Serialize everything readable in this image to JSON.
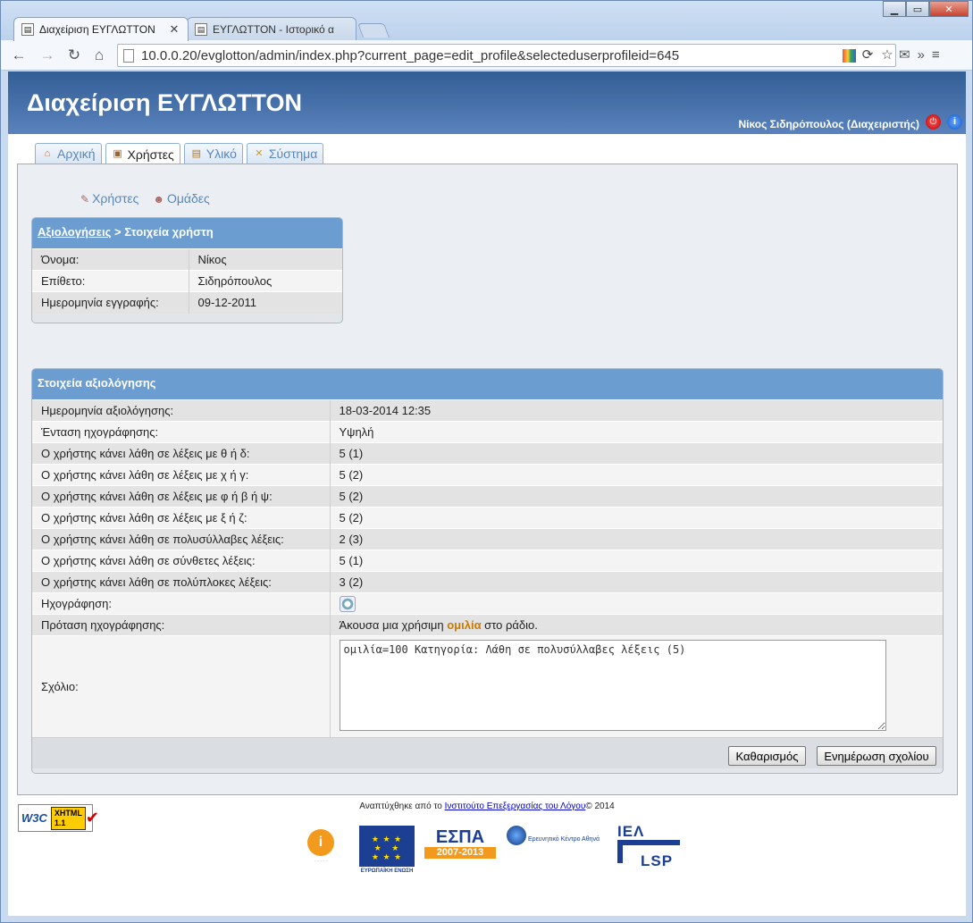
{
  "browser": {
    "tabs": [
      {
        "title": "Διαχείριση ΕΥΓΛΩΤΤΟΝ",
        "active": true
      },
      {
        "title": "ΕΥΓΛΩΤΤΟΝ - Ιστορικό α",
        "active": false
      }
    ],
    "url": "10.0.0.20/evglotton/admin/index.php?current_page=edit_profile&selecteduserprofileid=645",
    "icons": [
      "back-icon",
      "forward-icon",
      "reload-icon",
      "home-icon",
      "star-icon",
      "gmail-icon",
      "extensions-icon",
      "wrench-icon"
    ]
  },
  "header": {
    "title": "Διαχείριση ΕΥΓΛΩΤΤΟΝ",
    "user": "Νίκος Σιδηρόπουλος (Διαχειριστής)"
  },
  "main_tabs": [
    {
      "label": "Αρχική",
      "icon": "home-icon",
      "active": false
    },
    {
      "label": "Χρήστες",
      "icon": "users-icon",
      "active": true
    },
    {
      "label": "Υλικό",
      "icon": "book-icon",
      "active": false
    },
    {
      "label": "Σύστημα",
      "icon": "tools-icon",
      "active": false
    }
  ],
  "subnav": [
    {
      "label": "Χρήστες",
      "icon": "pencil-icon"
    },
    {
      "label": "Ομάδες",
      "icon": "group-icon"
    }
  ],
  "user_box": {
    "breadcrumb_link": "Αξιολογήσεις",
    "breadcrumb_sep": " > ",
    "breadcrumb_current": "Στοιχεία χρήστη",
    "rows": [
      {
        "key": "Όνομα:",
        "value": "Νίκος"
      },
      {
        "key": "Επίθετο:",
        "value": "Σιδηρόπουλος"
      },
      {
        "key": "Ημερομηνία εγγραφής:",
        "value": "09-12-2011"
      }
    ]
  },
  "eval_box": {
    "title": "Στοιχεία αξιολόγησης",
    "rows": [
      {
        "key": "Ημερομηνία αξιολόγησης:",
        "value": "18-03-2014 12:35"
      },
      {
        "key": "Ένταση ηχογράφησης:",
        "value": "Υψηλή"
      },
      {
        "key": "Ο χρήστης κάνει λάθη σε λέξεις με θ ή δ:",
        "value": "5 (1)"
      },
      {
        "key": "Ο χρήστης κάνει λάθη σε λέξεις με χ ή γ:",
        "value": "5 (2)"
      },
      {
        "key": "Ο χρήστης κάνει λάθη σε λέξεις με φ ή β ή ψ:",
        "value": "5 (2)"
      },
      {
        "key": "Ο χρήστης κάνει λάθη σε λέξεις με ξ ή ζ:",
        "value": "5 (2)"
      },
      {
        "key": "Ο χρήστης κάνει λάθη σε πολυσύλλαβες λέξεις:",
        "value": "2 (3)"
      },
      {
        "key": "Ο χρήστης κάνει λάθη σε σύνθετες λέξεις:",
        "value": "5 (1)"
      },
      {
        "key": "Ο χρήστης κάνει λάθη σε πολύπλοκες λέξεις:",
        "value": "3 (2)"
      }
    ],
    "recording_label": "Ηχογράφηση:",
    "sentence_label": "Πρόταση ηχογράφησης:",
    "sentence_before": "Άκουσα μια χρήσιμη ",
    "sentence_highlight": "ομιλία",
    "sentence_after": " στο ράδιο.",
    "comment_label": "Σχόλιο:",
    "comment_value": "ομιλία=100 Κατηγορία: Λάθη σε πολυσύλλαβες λέξεις (5)",
    "clear_button": "Καθαρισμός",
    "update_button": "Ενημέρωση σχολίου"
  },
  "footer": {
    "text_before": "Αναπτύχθηκε από το ",
    "link": "Ινστιτούτο Επεξεργασίας του Λόγου",
    "text_after": "© 2014",
    "w3c_badge": "W3C",
    "w3c_xhtml": "XHTML",
    "w3c_version": "1.1",
    "logos": {
      "eu_caption": "ΕΥΡΩΠΑΪΚΗ ΕΝΩΣΗ",
      "espa_title": "ΕΣΠΑ",
      "espa_years": "2007-2013",
      "athena_name": "Ερευνητικό Κέντρο Αθηνά",
      "iel_top": "ΙΕΛ",
      "iel_bottom": "LSP"
    }
  }
}
